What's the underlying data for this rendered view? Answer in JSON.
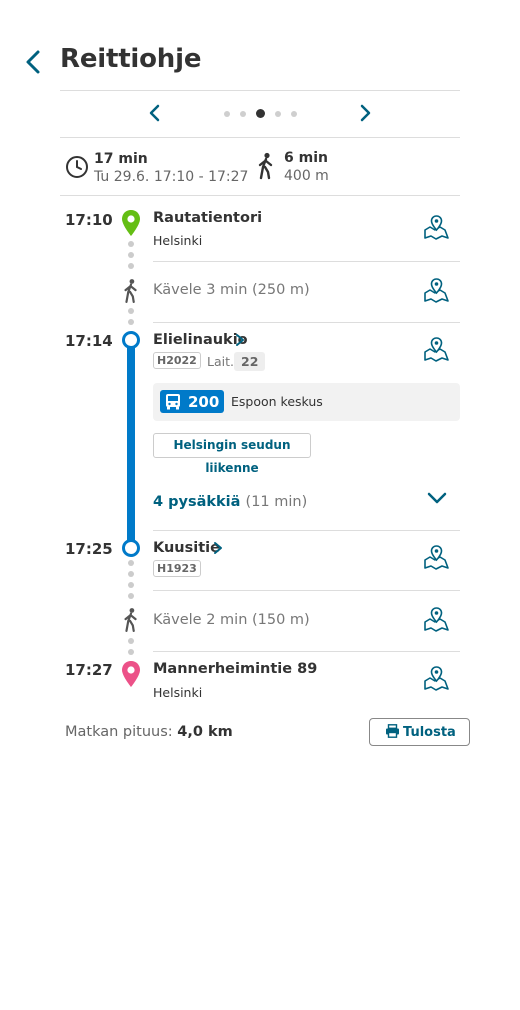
{
  "header": {
    "title": "Reittiohje",
    "back_icon": "chevron-left-icon"
  },
  "pager": {
    "pages": 5,
    "active_index": 2
  },
  "summary": {
    "duration": "17 min",
    "date_range": "Tu 29.6. 17:10 - 17:27",
    "walk_duration": "6 min",
    "walk_distance": "400 m"
  },
  "legs": {
    "start": {
      "time": "17:10",
      "name": "Rautatientori",
      "city": "Helsinki"
    },
    "walk1": {
      "text": "Kävele 3 min (250 m)"
    },
    "board": {
      "time": "17:14",
      "name": "Elielinaukio",
      "code": "H2022",
      "platform_label": "Lait.",
      "platform": "22"
    },
    "route": {
      "number": "200",
      "destination": "Espoon keskus",
      "agency": "Helsingin seudun liikenne",
      "stops": "4 pysäkkiä",
      "stops_duration": "(11 min)"
    },
    "alight": {
      "time": "17:25",
      "name": "Kuusitie",
      "code": "H1923"
    },
    "walk2": {
      "text": "Kävele 2 min (150 m)"
    },
    "end": {
      "time": "17:27",
      "name": "Mannerheimintie 89",
      "city": "Helsinki"
    }
  },
  "footer": {
    "length_label": "Matkan pituus:",
    "length_value": "4,0 km",
    "print_label": "Tulosta"
  },
  "colors": {
    "bus": "#007ac9",
    "teal": "#00617f",
    "start_marker": "#64be14",
    "end_marker": "#ec5188"
  }
}
